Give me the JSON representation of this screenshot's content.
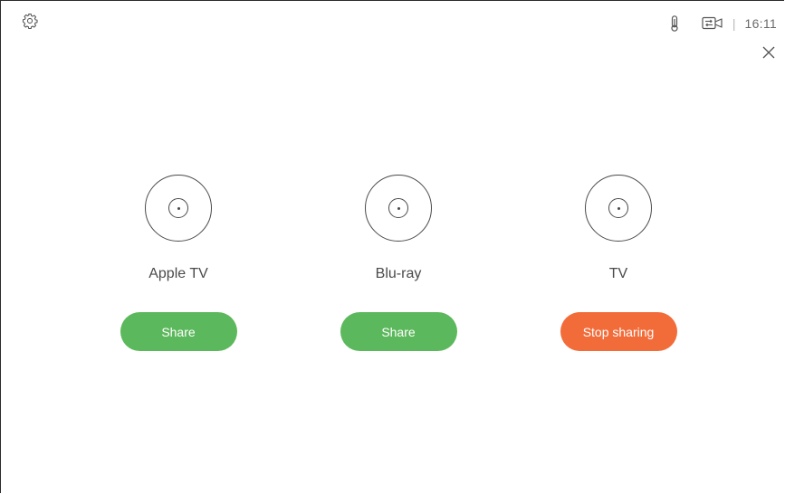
{
  "status_bar": {
    "time": "16:11",
    "separator": "|",
    "icons": [
      "thermometer-icon",
      "camera-share-icon"
    ]
  },
  "toolbar": {
    "settings_icon": "gear-icon",
    "close_icon": "close-icon"
  },
  "sources": [
    {
      "label": "Apple TV",
      "button_label": "Share",
      "state": "idle",
      "icon": "disc-icon"
    },
    {
      "label": "Blu-ray",
      "button_label": "Share",
      "state": "idle",
      "icon": "disc-icon"
    },
    {
      "label": "TV",
      "button_label": "Stop sharing",
      "state": "sharing",
      "icon": "disc-icon"
    }
  ],
  "colors": {
    "share": "#5cb85c",
    "stop_sharing": "#f26c3a",
    "text": "#4a4a4a"
  }
}
